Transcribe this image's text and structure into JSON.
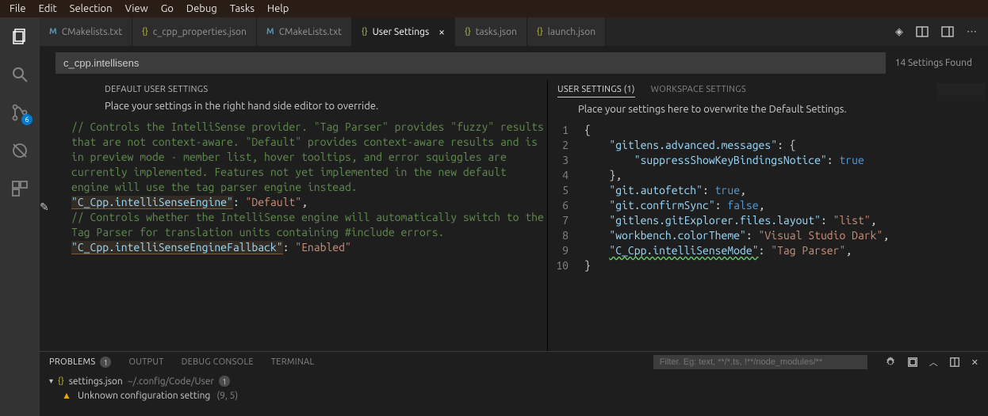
{
  "menu": [
    "File",
    "Edit",
    "Selection",
    "View",
    "Go",
    "Debug",
    "Tasks",
    "Help"
  ],
  "activity": {
    "scm_badge": "6"
  },
  "tabs": [
    {
      "label": "CMakelists.txt",
      "type": "m"
    },
    {
      "label": "c_cpp_properties.json",
      "type": "j"
    },
    {
      "label": "CMakeLists.txt",
      "type": "m"
    },
    {
      "label": "User Settings",
      "type": "j",
      "active": true,
      "close": true
    },
    {
      "label": "tasks.json",
      "type": "j"
    },
    {
      "label": "launch.json",
      "type": "j"
    }
  ],
  "search": {
    "value": "c_cpp.intellisens",
    "found": "14 Settings Found"
  },
  "left": {
    "header": "DEFAULT USER SETTINGS",
    "desc": "Place your settings in the right hand side editor to override.",
    "comment1": "// Controls the IntelliSense provider. \"Tag Parser\" provides \"fuzzy\" results that are not context-aware. \"Default\" provides context-aware results and is in preview mode - member list, hover tooltips, and error squiggles are currently implemented. Features not yet implemented in the new default engine will use the tag parser engine instead.",
    "key1": "\"C_Cpp.intelliSenseEngine\"",
    "val1": "\"Default\"",
    "comment2": "// Controls whether the IntelliSense engine will automatically switch to the Tag Parser for translation units containing #include errors.",
    "key2": "\"C_Cpp.intelliSenseEngineFallback\"",
    "val2": "\"Enabled\""
  },
  "right": {
    "tab_user": "USER SETTINGS (1)",
    "tab_ws": "WORKSPACE SETTINGS",
    "desc": "Place your settings here to overwrite the Default Settings.",
    "lines": {
      "l1": "{",
      "l2_k": "\"gitlens.advanced.messages\"",
      "l2_r": ": {",
      "l3_k": "\"suppressShowKeyBindingsNotice\"",
      "l3_v": "true",
      "l4": "},",
      "l5_k": "\"git.autofetch\"",
      "l5_v": "true",
      "l6_k": "\"git.confirmSync\"",
      "l6_v": "false",
      "l7_k": "\"gitlens.gitExplorer.files.layout\"",
      "l7_v": "\"list\"",
      "l8_k": "\"workbench.colorTheme\"",
      "l8_v": "\"Visual Studio Dark\"",
      "l9_k": "\"C_Cpp.intelliSenseMode\"",
      "l9_v": "\"Tag Parser\"",
      "l10": "}"
    },
    "line_numbers": [
      "1",
      "2",
      "3",
      "4",
      "5",
      "6",
      "7",
      "8",
      "9",
      "10"
    ]
  },
  "panel": {
    "tabs": {
      "problems": "PROBLEMS",
      "output": "OUTPUT",
      "debug": "DEBUG CONSOLE",
      "terminal": "TERMINAL"
    },
    "problems_count": "1",
    "filter_placeholder": "Filter. Eg: text, **/*.ts, !**/node_modules/**",
    "file": "settings.json",
    "file_path": "~/.config/Code/User",
    "file_count": "1",
    "msg": "Unknown configuration setting",
    "loc": "(9, 5)"
  }
}
